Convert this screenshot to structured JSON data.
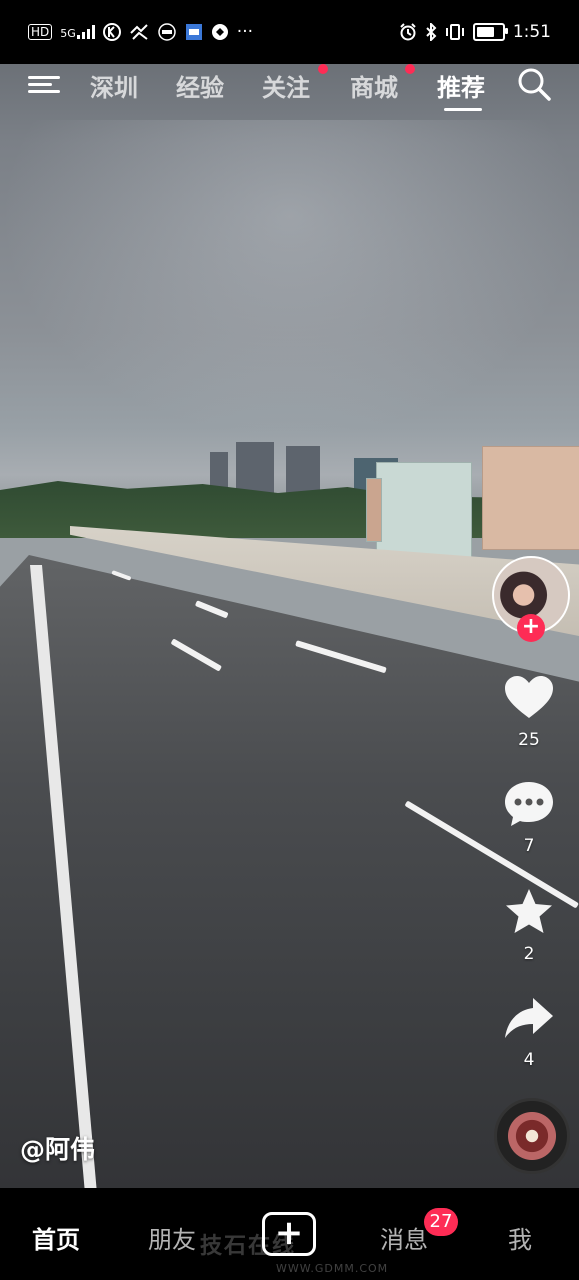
{
  "status_bar": {
    "time": "1:51",
    "network_label": "HD",
    "signal_label": "5G",
    "battery_level": 0.85,
    "left_icons": [
      "hd-icon",
      "signal-icon",
      "k-app-icon",
      "app-icon",
      "ipm-app-icon",
      "jdm-app-icon",
      "browser-icon",
      "more-dots-icon"
    ],
    "more": "···"
  },
  "top_nav": {
    "tabs": [
      {
        "label": "深圳",
        "active": false,
        "dot": false
      },
      {
        "label": "经验",
        "active": false,
        "dot": false
      },
      {
        "label": "关注",
        "active": false,
        "dot": true
      },
      {
        "label": "商城",
        "active": false,
        "dot": true
      },
      {
        "label": "推荐",
        "active": true,
        "dot": false
      }
    ],
    "dot_color": "#fe2c55"
  },
  "right_rail": {
    "like_count": "25",
    "comment_count": "7",
    "favorite_count": "2",
    "share_count": "4",
    "follow_symbol": "+",
    "accent": "#fe2c55"
  },
  "video": {
    "author": "@阿伟"
  },
  "bottom_nav": {
    "items": [
      {
        "label": "首页",
        "active": true
      },
      {
        "label": "朋友",
        "active": false
      },
      {
        "label": "消息",
        "active": false
      },
      {
        "label": "我",
        "active": false
      }
    ],
    "create_symbol": "+",
    "message_badge": "27"
  },
  "watermark": {
    "text": "技石在线",
    "url": "WWW.GDMM.COM"
  }
}
